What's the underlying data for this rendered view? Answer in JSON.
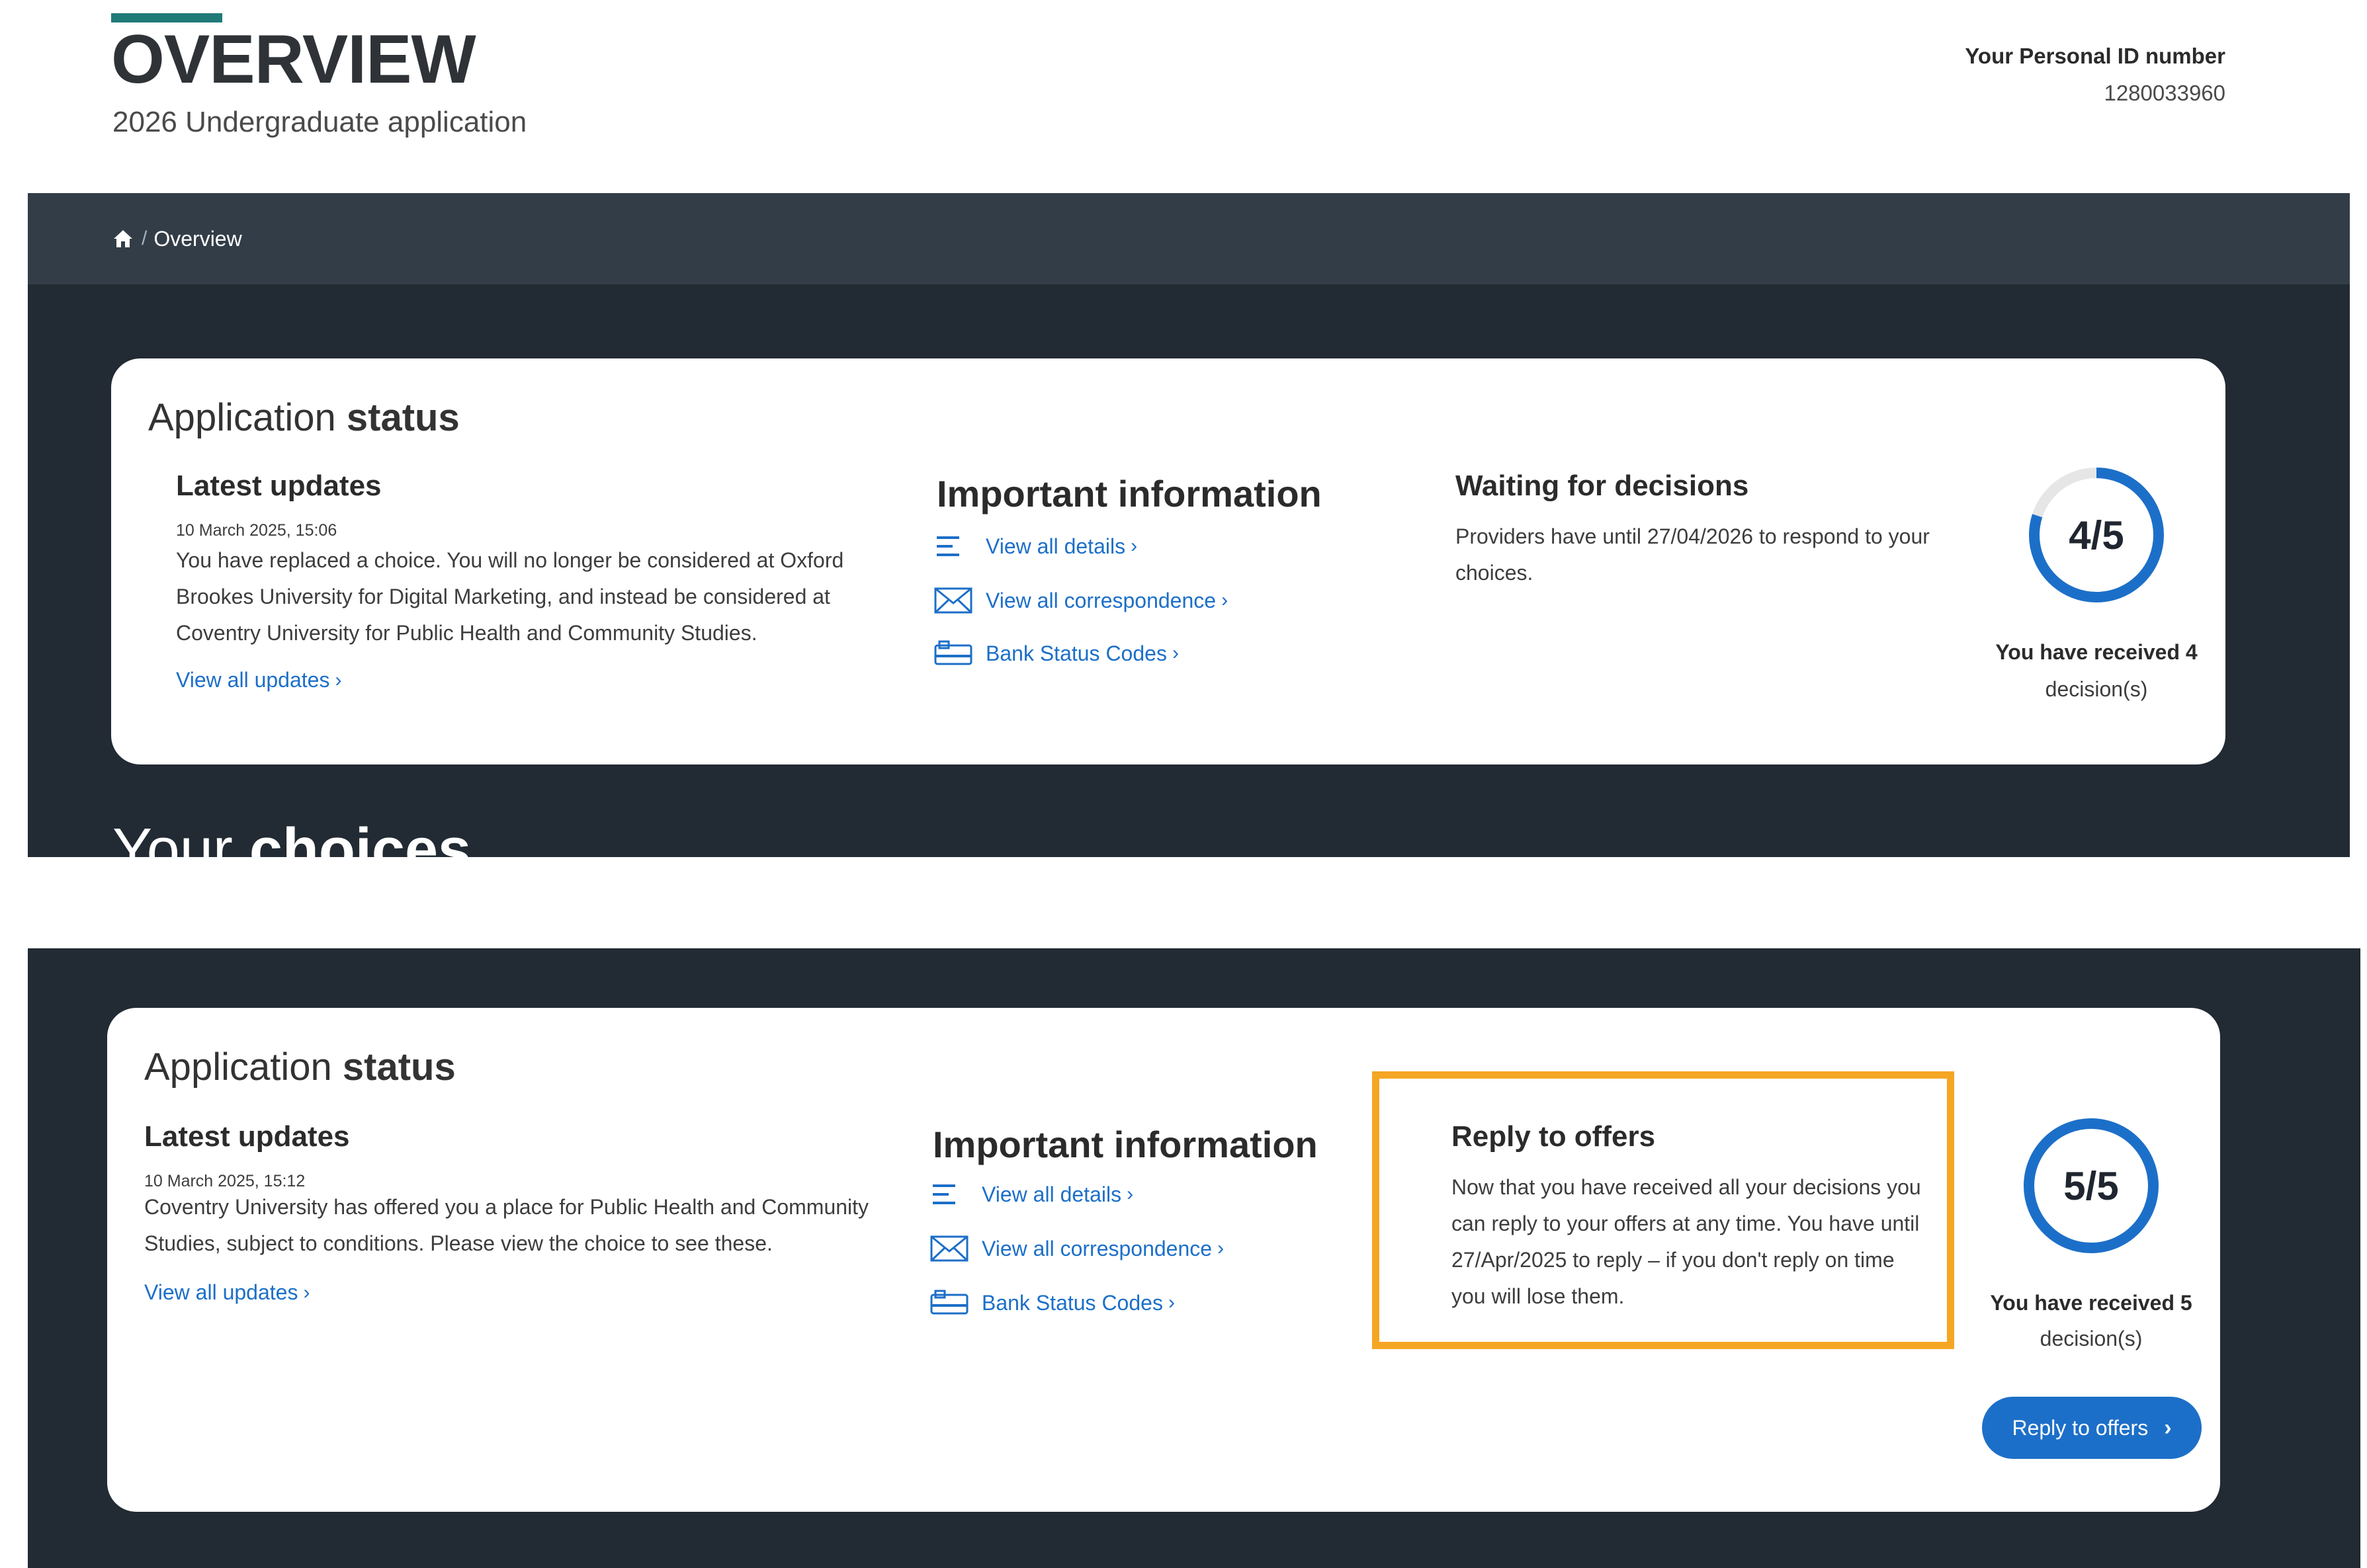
{
  "header": {
    "title": "OVERVIEW",
    "subtitle": "2026 Undergraduate application",
    "personal_id_label": "Your Personal ID number",
    "personal_id_value": "1280033960"
  },
  "breadcrumb": {
    "home_icon": "home-icon",
    "separator": "/",
    "current": "Overview"
  },
  "cutoff_heading": {
    "prefix": "Your",
    "bold": "choices"
  },
  "status_before": {
    "title_regular": "Application",
    "title_bold": "status",
    "latest": {
      "heading": "Latest updates",
      "date": "10 March 2025, 15:06",
      "text": "You have replaced a choice. You will no longer be considered at Oxford Brookes University for Digital Marketing, and instead be considered at Coventry University for Public Health and Community Studies.",
      "link": "View all updates"
    },
    "important": {
      "heading": "Important information",
      "links": [
        {
          "icon": "list-icon",
          "label": "View all details"
        },
        {
          "icon": "envelope-icon",
          "label": "View all correspondence"
        },
        {
          "icon": "bank-card-icon",
          "label": "Bank Status Codes"
        }
      ]
    },
    "waiting": {
      "heading": "Waiting for decisions",
      "text": "Providers have until 27/04/2026 to respond to your choices."
    },
    "decisions": {
      "ring_label": "4/5",
      "received": 4,
      "total": 5,
      "received_text": "You have received 4",
      "suffix": "decision(s)"
    }
  },
  "status_after": {
    "title_regular": "Application",
    "title_bold": "status",
    "latest": {
      "heading": "Latest updates",
      "date": "10 March 2025, 15:12",
      "text": "Coventry University has offered you a place for Public Health and Community Studies, subject to conditions. Please view the choice to see these.",
      "link": "View all updates"
    },
    "important": {
      "heading": "Important information",
      "links": [
        {
          "icon": "list-icon",
          "label": "View all details"
        },
        {
          "icon": "envelope-icon",
          "label": "View all correspondence"
        },
        {
          "icon": "bank-card-icon",
          "label": "Bank Status Codes"
        }
      ]
    },
    "reply": {
      "heading": "Reply to offers",
      "text": "Now that you have received all your decisions you can reply to your offers at any time. You have until 27/Apr/2025 to reply – if you don't reply on time you will lose them."
    },
    "decisions": {
      "ring_label": "5/5",
      "received": 5,
      "total": 5,
      "received_text": "You have received 5",
      "suffix": "decision(s)"
    },
    "reply_button": "Reply to offers"
  },
  "colors": {
    "accent": "#1f7a78",
    "dark_panel": "#222a33",
    "breadcrumb_bar": "#333d47",
    "link": "#1c6fc8",
    "ring_track": "#e6e6e6",
    "highlight": "#f5a623"
  }
}
